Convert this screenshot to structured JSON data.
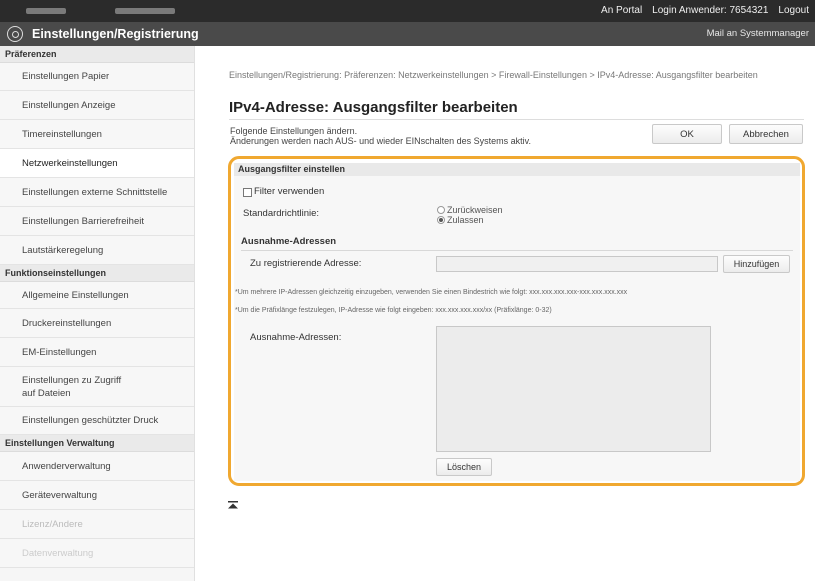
{
  "header": {
    "portal_link": "An Portal",
    "login_label": "Login Anwender:",
    "login_user": "7654321",
    "logout_link": "Logout",
    "app_title": "Einstellungen/Registrierung",
    "mail_link": "Mail an Systemmanager"
  },
  "sidebar": {
    "sections": [
      {
        "title": "Präferenzen",
        "items": [
          {
            "label": "Einstellungen Papier"
          },
          {
            "label": "Einstellungen Anzeige"
          },
          {
            "label": "Timereinstellungen"
          },
          {
            "label": "Netzwerkeinstellungen",
            "active": true
          },
          {
            "label": "Einstellungen externe Schnittstelle"
          },
          {
            "label": "Einstellungen Barrierefreiheit"
          },
          {
            "label": "Lautstärkeregelung"
          }
        ]
      },
      {
        "title": "Funktionseinstellungen",
        "items": [
          {
            "label": "Allgemeine Einstellungen"
          },
          {
            "label": "Druckereinstellungen"
          },
          {
            "label": "EM-Einstellungen"
          },
          {
            "label": "Einstellungen zu Zugriff auf Dateien"
          },
          {
            "label": "Einstellungen geschützter Druck"
          }
        ]
      },
      {
        "title": "Einstellungen Verwaltung",
        "items": [
          {
            "label": "Anwenderverwaltung"
          },
          {
            "label": "Geräteverwaltung"
          },
          {
            "label": "Lizenz/Andere",
            "faded": true
          },
          {
            "label": "Datenverwaltung",
            "faded": true
          }
        ]
      }
    ]
  },
  "main": {
    "breadcrumb": "Einstellungen/Registrierung: Präferenzen: Netzwerkeinstellungen > Firewall-Einstellungen > IPv4-Adresse: Ausgangsfilter bearbeiten",
    "title": "IPv4-Adresse: Ausgangsfilter bearbeiten",
    "intro_line1": "Folgende Einstellungen ändern.",
    "intro_line2": "Änderungen werden nach AUS- und wieder EINschalten des Systems aktiv.",
    "ok_label": "OK",
    "cancel_label": "Abbrechen"
  },
  "panel": {
    "header": "Ausgangsfilter einstellen",
    "use_filter": {
      "label": "Filter verwenden",
      "checked": false
    },
    "default_policy": {
      "label": "Standardrichtlinie:",
      "options": [
        {
          "label": "Zurückweisen",
          "selected": false
        },
        {
          "label": "Zulassen",
          "selected": true
        }
      ]
    },
    "exceptions_heading": "Ausnahme-Adressen",
    "register_label": "Zu registrierende Adresse:",
    "register_value": "",
    "add_label": "Hinzufügen",
    "note1": "*Um mehrere IP-Adressen gleichzeitig einzugeben, verwenden Sie einen Bindestrich wie folgt: xxx.xxx.xxx.xxx-xxx.xxx.xxx.xxx",
    "note2": "*Um die Präfixlänge festzulegen, IP-Adresse wie folgt eingeben: xxx.xxx.xxx.xxx/xx (Präfixlänge: 0-32)",
    "list_label": "Ausnahme-Adressen:",
    "delete_label": "Löschen"
  },
  "colors": {
    "highlight": "#f0a830",
    "topbar": "#2b2b2b",
    "titlebar": "#4a4a4a"
  }
}
